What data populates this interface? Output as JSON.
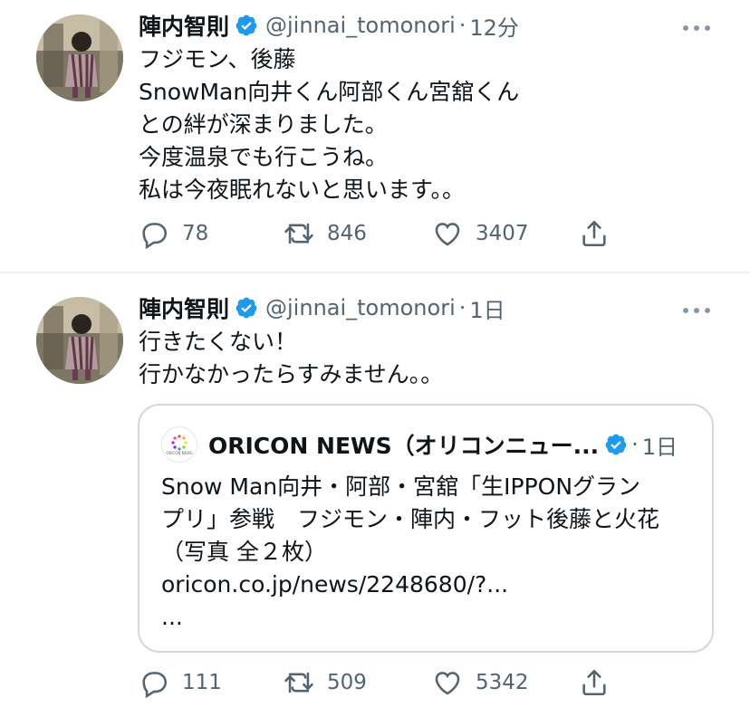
{
  "tweets": [
    {
      "author_name": "陣内智則",
      "handle": "@jinnai_tomonori",
      "separator": "·",
      "time": "12分",
      "lines": [
        "フジモン、後藤",
        "SnowMan向井くん阿部くん宮舘くん",
        "との絆が深まりました。",
        "今度温泉でも行こうね。",
        "私は今夜眠れないと思います。。"
      ],
      "replies": "78",
      "retweets": "846",
      "likes": "3407"
    },
    {
      "author_name": "陣内智則",
      "handle": "@jinnai_tomonori",
      "separator": "·",
      "time": "1日",
      "lines": [
        "行きたくない！",
        "行かなかったらすみません。。"
      ],
      "quote": {
        "logo_text": "ORICON NEWS",
        "author_name": "ORICON NEWS（オリコンニュー...",
        "separator": "·",
        "time": "1日",
        "lines": [
          "Snow Man向井・阿部・宮舘「生IPPONグラン",
          "プリ」参戦　フジモン・陣内・フット後藤と火花",
          "（写真 全２枚）",
          "oricon.co.jp/news/2248680/?...",
          "..."
        ]
      },
      "replies": "111",
      "retweets": "509",
      "likes": "5342"
    }
  ],
  "colors": {
    "verified": "#1d9bf0",
    "secondary_text": "#536471",
    "divider": "#eff3f4"
  },
  "icons": [
    "reply-icon",
    "retweet-icon",
    "like-icon",
    "share-icon",
    "verified-icon",
    "more-icon"
  ]
}
